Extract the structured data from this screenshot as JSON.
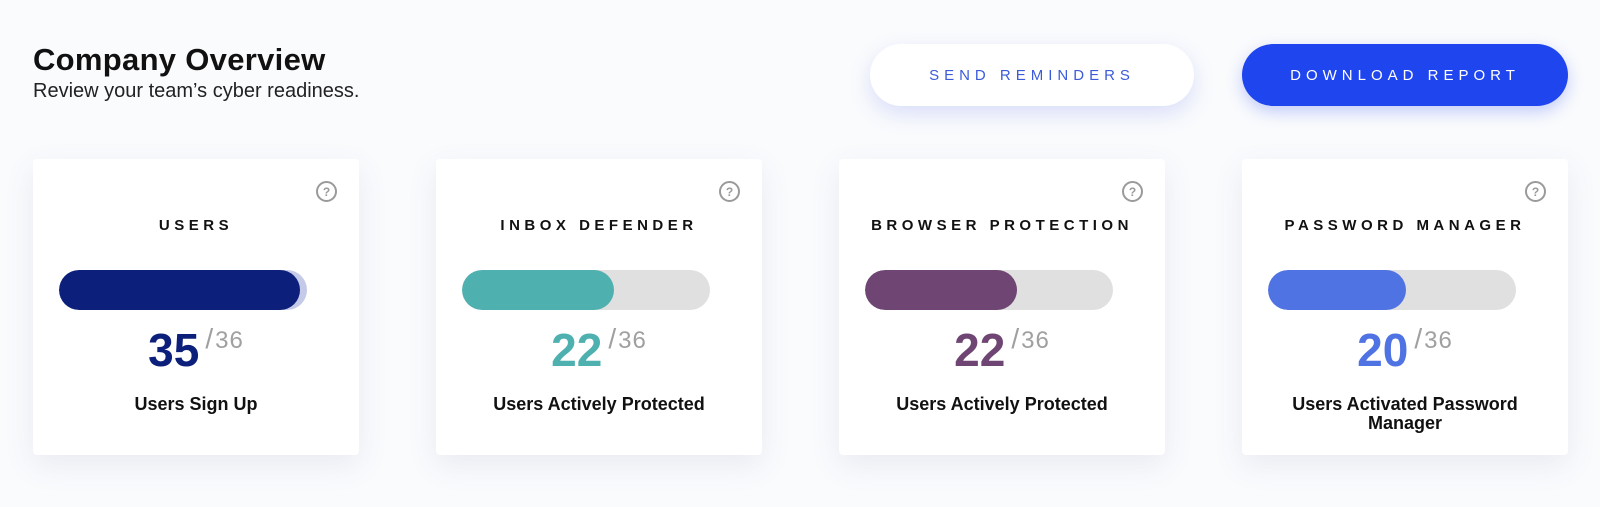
{
  "header": {
    "title": "Company Overview",
    "subtitle": "Review your team’s cyber readiness."
  },
  "actions": {
    "send_reminders": "SEND REMINDERS",
    "download_report": "DOWNLOAD REPORT"
  },
  "cards": [
    {
      "title": "USERS",
      "value": "35",
      "total": "36",
      "separator": "/",
      "caption": "Users Sign Up",
      "color": "#0c1f7a",
      "progress": 0.97,
      "help_icon": "question-circle-icon"
    },
    {
      "title": "INBOX DEFENDER",
      "value": "22",
      "total": "36",
      "separator": "/",
      "caption": "Users Actively Protected",
      "color": "#4fb0b0",
      "progress": 0.611,
      "help_icon": "question-circle-icon"
    },
    {
      "title": "BROWSER PROTECTION",
      "value": "22",
      "total": "36",
      "separator": "/",
      "caption": "Users Actively Protected",
      "color": "#6f4673",
      "progress": 0.611,
      "help_icon": "question-circle-icon"
    },
    {
      "title": "PASSWORD MANAGER",
      "value": "20",
      "total": "36",
      "separator": "/",
      "caption": "Users Activated Password Manager",
      "color": "#5073e4",
      "progress": 0.556,
      "help_icon": "question-circle-icon"
    }
  ],
  "colors": {
    "primary_button": "#1f45ee",
    "secondary_button_text": "#3b5bd9",
    "track": "#e0e0e0",
    "users_track": "#c5cae8"
  }
}
